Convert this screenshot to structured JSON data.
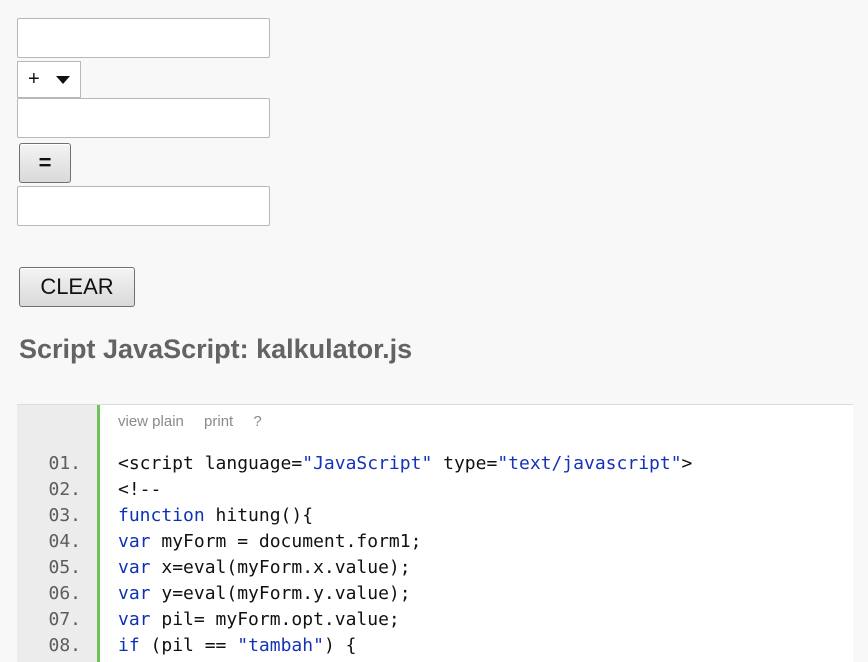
{
  "form": {
    "input_x_value": "",
    "operator_selected": "+",
    "input_y_value": "",
    "equals_label": "=",
    "result_value": "",
    "clear_label": "CLEAR"
  },
  "section_title": "Script JavaScript: kalkulator.js",
  "code_toolbar": {
    "view_plain": "view plain",
    "print": "print",
    "help": "?"
  },
  "code_lines": [
    {
      "num": "01.",
      "parts": [
        {
          "t": "<script language=",
          "c": ""
        },
        {
          "t": "\"JavaScript\"",
          "c": "str"
        },
        {
          "t": " type=",
          "c": ""
        },
        {
          "t": "\"text/javascript\"",
          "c": "str"
        },
        {
          "t": ">",
          "c": ""
        }
      ]
    },
    {
      "num": "02.",
      "parts": [
        {
          "t": "<!--",
          "c": ""
        }
      ]
    },
    {
      "num": "03.",
      "parts": [
        {
          "t": "function",
          "c": "kw"
        },
        {
          "t": " hitung(){",
          "c": ""
        }
      ]
    },
    {
      "num": "04.",
      "parts": [
        {
          "t": "var",
          "c": "kw"
        },
        {
          "t": " myForm = document.form1;",
          "c": ""
        }
      ]
    },
    {
      "num": "05.",
      "parts": [
        {
          "t": "var",
          "c": "kw"
        },
        {
          "t": " x=eval(myForm.x.value);",
          "c": ""
        }
      ]
    },
    {
      "num": "06.",
      "parts": [
        {
          "t": "var",
          "c": "kw"
        },
        {
          "t": " y=eval(myForm.y.value);",
          "c": ""
        }
      ]
    },
    {
      "num": "07.",
      "parts": [
        {
          "t": "var",
          "c": "kw"
        },
        {
          "t": " pil= myForm.opt.value;",
          "c": ""
        }
      ]
    },
    {
      "num": "08.",
      "parts": [
        {
          "t": "if",
          "c": "kw"
        },
        {
          "t": " (pil == ",
          "c": ""
        },
        {
          "t": "\"tambah\"",
          "c": "str"
        },
        {
          "t": ") {",
          "c": ""
        }
      ]
    }
  ]
}
